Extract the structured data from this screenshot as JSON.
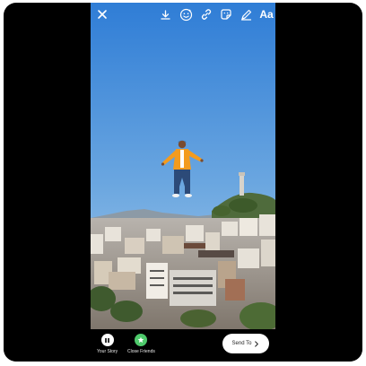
{
  "toolbar": {
    "close_icon": "close-icon",
    "download_icon": "download-icon",
    "sticker_face_icon": "sticker-face-icon",
    "link_icon": "link-icon",
    "sticker_icon": "sticker-icon",
    "draw_icon": "draw-icon",
    "text_tool_label": "Aa"
  },
  "bottom_bar": {
    "your_story_label": "Your Story",
    "close_friends_label": "Close Friends",
    "send_to_label": "Send To"
  },
  "colors": {
    "sky_top": "#2f7dd6",
    "sky_bottom": "#a9cde9",
    "close_friends_green": "#4ec96b",
    "jacket_orange": "#f39b1e",
    "jeans_blue": "#2c4a78"
  }
}
